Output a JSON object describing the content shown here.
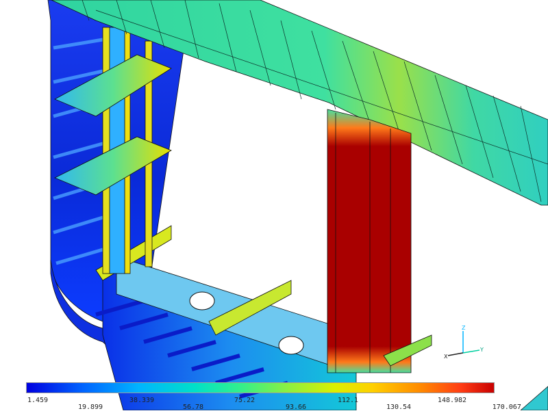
{
  "legend": {
    "top_row": [
      "1.459",
      "38.339",
      "75.22",
      "112.1",
      "148.982"
    ],
    "bottom_row": [
      "19.899",
      "56.78",
      "93.66",
      "130.54",
      "170.067"
    ]
  },
  "triad": {
    "labels": [
      "Z",
      "Y",
      "X"
    ]
  },
  "colors": {
    "low": "#0000e0",
    "mid_low": "#00b4ff",
    "mid": "#33e7a7",
    "mid_high": "#dcf000",
    "high": "#c80000"
  }
}
